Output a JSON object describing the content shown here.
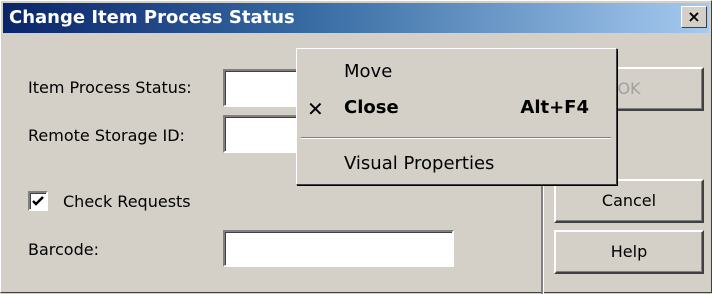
{
  "window": {
    "title": "Change Item Process Status",
    "close_glyph": "×"
  },
  "form": {
    "item_process_status_label": "Item Process Status:",
    "item_process_status_value": "",
    "remote_storage_id_label": "Remote Storage ID:",
    "remote_storage_id_value": "",
    "check_requests_label": "Check Requests",
    "check_requests_checked": true,
    "barcode_label": "Barcode:",
    "barcode_value": ""
  },
  "buttons": {
    "ok": "OK",
    "cancel": "Cancel",
    "help": "Help"
  },
  "context_menu": {
    "items": [
      {
        "label": "Move",
        "shortcut": ""
      },
      {
        "label": "Close",
        "shortcut": "Alt+F4",
        "icon": "close-x-icon"
      },
      {
        "label": "Visual Properties",
        "shortcut": ""
      }
    ]
  }
}
